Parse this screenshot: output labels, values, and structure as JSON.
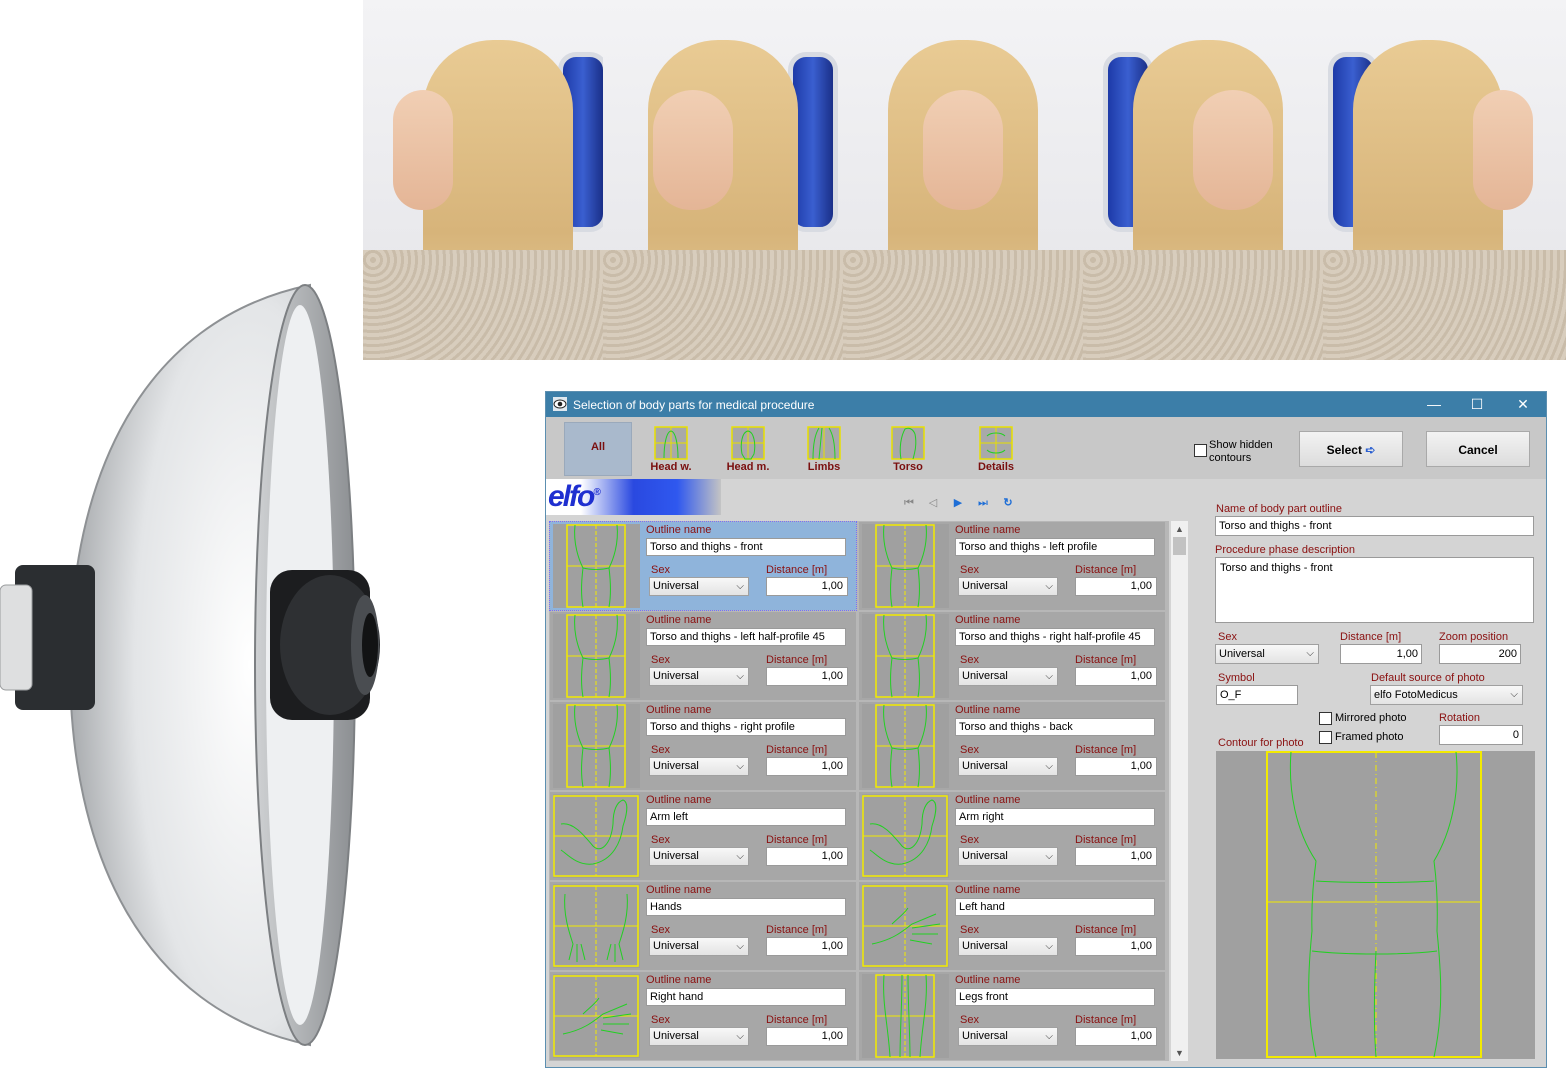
{
  "dialog": {
    "title": "Selection of body parts for medical procedure",
    "window_controls": {
      "minimize": "—",
      "maximize": "☐",
      "close": "✕"
    }
  },
  "toolbar": {
    "categories": [
      {
        "label": "All"
      },
      {
        "label": "Head w."
      },
      {
        "label": "Head m."
      },
      {
        "label": "Limbs"
      },
      {
        "label": "Torso"
      },
      {
        "label": "Details"
      }
    ],
    "show_hidden_label": "Show hidden contours",
    "select_label": "Select",
    "select_icon": "➪",
    "cancel_label": "Cancel"
  },
  "logo": {
    "text": "elfo",
    "mark": "®"
  },
  "nav": {
    "first": "⏮",
    "prev": "◁",
    "next": "▶",
    "last": "⏭",
    "refresh": "↻"
  },
  "list_labels": {
    "outline": "Outline name",
    "sex": "Sex",
    "distance": "Distance [m]"
  },
  "outlines": [
    {
      "name": "Torso and thighs - front",
      "sex": "Universal",
      "distance": "1,00",
      "thumb": "torso"
    },
    {
      "name": "Torso and thighs - left profile",
      "sex": "Universal",
      "distance": "1,00",
      "thumb": "torso"
    },
    {
      "name": "Torso and thighs - left half-profile 45",
      "sex": "Universal",
      "distance": "1,00",
      "thumb": "torso"
    },
    {
      "name": "Torso and thighs - right half-profile 45",
      "sex": "Universal",
      "distance": "1,00",
      "thumb": "torso"
    },
    {
      "name": "Torso and thighs - right profile",
      "sex": "Universal",
      "distance": "1,00",
      "thumb": "torso"
    },
    {
      "name": "Torso and thighs - back",
      "sex": "Universal",
      "distance": "1,00",
      "thumb": "torso"
    },
    {
      "name": "Arm left",
      "sex": "Universal",
      "distance": "1,00",
      "thumb": "arm"
    },
    {
      "name": "Arm right",
      "sex": "Universal",
      "distance": "1,00",
      "thumb": "arm"
    },
    {
      "name": "Hands",
      "sex": "Universal",
      "distance": "1,00",
      "thumb": "hands"
    },
    {
      "name": "Left hand",
      "sex": "Universal",
      "distance": "1,00",
      "thumb": "hand"
    },
    {
      "name": "Right hand",
      "sex": "Universal",
      "distance": "1,00",
      "thumb": "hand"
    },
    {
      "name": "Legs front",
      "sex": "Universal",
      "distance": "1,00",
      "thumb": "legs"
    }
  ],
  "scroll": {
    "up": "▲",
    "down": "▼"
  },
  "details": {
    "name_label": "Name of body part outline",
    "name_value": "Torso and thighs - front",
    "phase_label": "Procedure phase description",
    "phase_value": "Torso and thighs - front",
    "sex_label": "Sex",
    "sex_value": "Universal",
    "distance_label": "Distance [m]",
    "distance_value": "1,00",
    "zoom_label": "Zoom position",
    "zoom_value": "200",
    "symbol_label": "Symbol",
    "symbol_value": "O_F",
    "source_label": "Default source of photo",
    "source_value": "elfo FotoMedicus",
    "mirrored_label": "Mirrored photo",
    "framed_label": "Framed photo",
    "rotation_label": "Rotation",
    "rotation_value": "0",
    "contour_label": "Contour for photo"
  },
  "colors": {
    "titlebar": "#3c7ea8",
    "label_red": "#8a1010",
    "outline_green": "#22d022",
    "frame_yellow": "#f2ea00"
  }
}
